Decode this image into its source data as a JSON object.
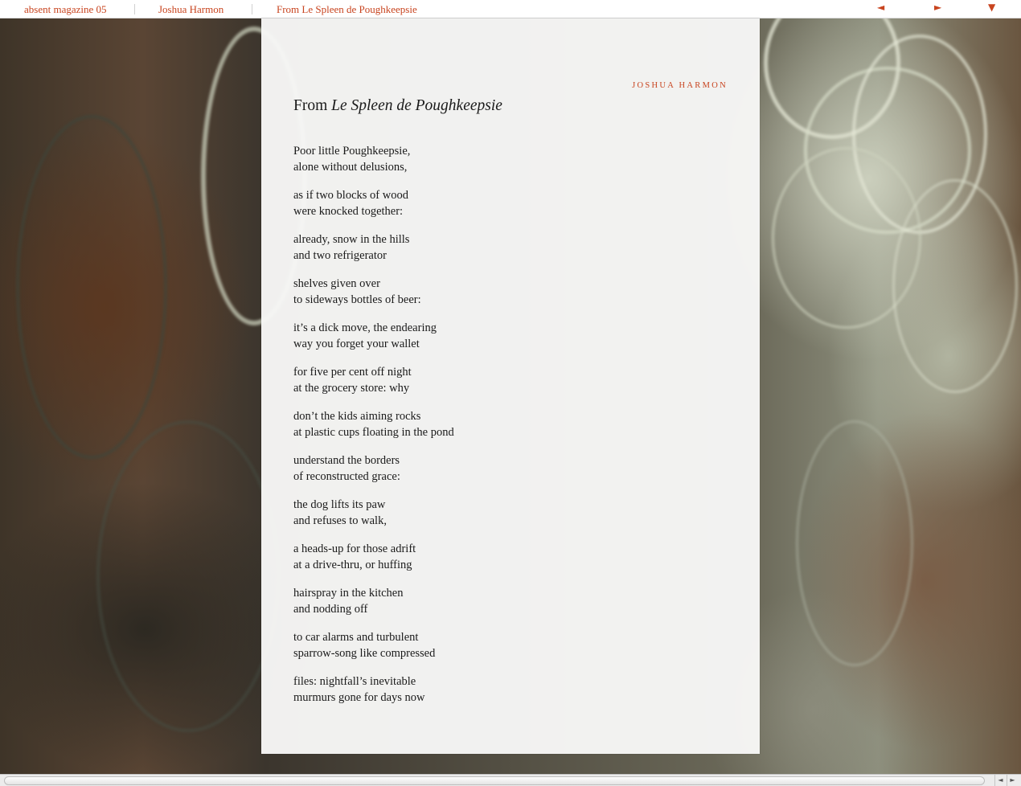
{
  "nav": {
    "crumbs": [
      "absent magazine 05",
      "Joshua Harmon",
      "From Le Spleen de Poughkeepsie"
    ],
    "prev_icon": "◄",
    "next_icon": "►",
    "menu_icon": "▼"
  },
  "article": {
    "byline": "JOSHUA HARMON",
    "title_prefix": "From ",
    "title_italic": "Le Spleen de Poughkeepsie",
    "stanzas": [
      [
        "Poor little Poughkeepsie,",
        "alone without delusions,"
      ],
      [
        "as if two blocks of wood",
        "were knocked together:"
      ],
      [
        "already, snow in the hills",
        "and two refrigerator"
      ],
      [
        "shelves given over",
        "to sideways bottles of beer:"
      ],
      [
        "it’s a dick move, the endearing",
        "way you forget your wallet"
      ],
      [
        "for five per cent off night",
        "at the grocery store: why"
      ],
      [
        "don’t the kids aiming rocks",
        "at plastic cups floating in the pond"
      ],
      [
        "understand the borders",
        "of reconstructed grace:"
      ],
      [
        "the dog lifts its paw",
        "and refuses to walk,"
      ],
      [
        "a heads-up for those adrift",
        "at a drive-thru, or huffing"
      ],
      [
        "hairspray in the kitchen",
        "and nodding off"
      ],
      [
        "to car alarms and turbulent",
        "sparrow-song like compressed"
      ],
      [
        "files: nightfall’s inevitable",
        "murmurs gone for days now"
      ]
    ]
  },
  "scrollbar": {
    "left_icon": "◄",
    "right_icon": "►"
  },
  "colors": {
    "accent": "#c8441f",
    "paper": "#f7f7f6",
    "text": "#1a1a1a"
  }
}
